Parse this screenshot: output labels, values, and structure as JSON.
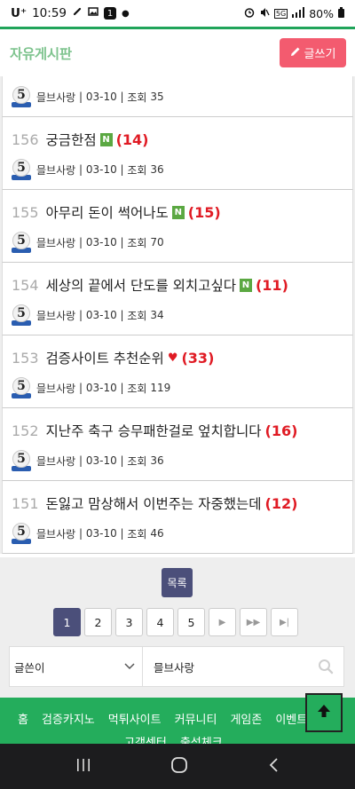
{
  "status": {
    "carrier": "U⁺",
    "time": "10:59",
    "notif_count": "1",
    "network": "5G",
    "battery": "80%"
  },
  "header": {
    "title": "자유게시판",
    "write_button": "글쓰기"
  },
  "posts": [
    {
      "num": "",
      "title": "",
      "new": false,
      "hot": false,
      "comments": "",
      "author": "믈브사랑",
      "date": "03-10",
      "views_label": "조회",
      "views": "35"
    },
    {
      "num": "156",
      "title": "궁금한점",
      "new": true,
      "hot": false,
      "comments": "(14)",
      "author": "믈브사랑",
      "date": "03-10",
      "views_label": "조회",
      "views": "36"
    },
    {
      "num": "155",
      "title": "아무리 돈이 썩어나도",
      "new": true,
      "hot": false,
      "comments": "(15)",
      "author": "믈브사랑",
      "date": "03-10",
      "views_label": "조회",
      "views": "70"
    },
    {
      "num": "154",
      "title": "세상의 끝에서 단도를 외치고싶다",
      "new": true,
      "hot": false,
      "comments": "(11)",
      "author": "믈브사랑",
      "date": "03-10",
      "views_label": "조회",
      "views": "34"
    },
    {
      "num": "153",
      "title": "검증사이트 추천순위",
      "new": false,
      "hot": true,
      "comments": "(33)",
      "author": "믈브사랑",
      "date": "03-10",
      "views_label": "조회",
      "views": "119"
    },
    {
      "num": "152",
      "title": "지난주 축구 승무패한걸로 엎치합니다",
      "new": false,
      "hot": false,
      "comments": "(16)",
      "author": "믈브사랑",
      "date": "03-10",
      "views_label": "조회",
      "views": "36"
    },
    {
      "num": "151",
      "title": "돈잃고 맘상해서 이번주는 자중했는데",
      "new": false,
      "hot": false,
      "comments": "(12)",
      "author": "믈브사랑",
      "date": "03-10",
      "views_label": "조회",
      "views": "46"
    }
  ],
  "new_badge": "N",
  "level_badge": "5",
  "list_button": "목록",
  "pagination": {
    "pages": [
      "1",
      "2",
      "3",
      "4",
      "5"
    ],
    "current": "1",
    "next": "▶",
    "next_block": "▶▶",
    "last": "▶|"
  },
  "search": {
    "field_option": "글쓴이",
    "query": "믈브사랑"
  },
  "footer_nav": [
    "홈",
    "검증카지노",
    "먹튀사이트",
    "커뮤니티",
    "게임존",
    "이벤트"
  ],
  "footer_nav2": [
    "고객센터",
    "출석체크"
  ],
  "colors": {
    "accent_green": "#24ad5c",
    "write_pink": "#f35b6f",
    "comment_red": "#e01b24",
    "pager_navy": "#4b4f7a"
  }
}
